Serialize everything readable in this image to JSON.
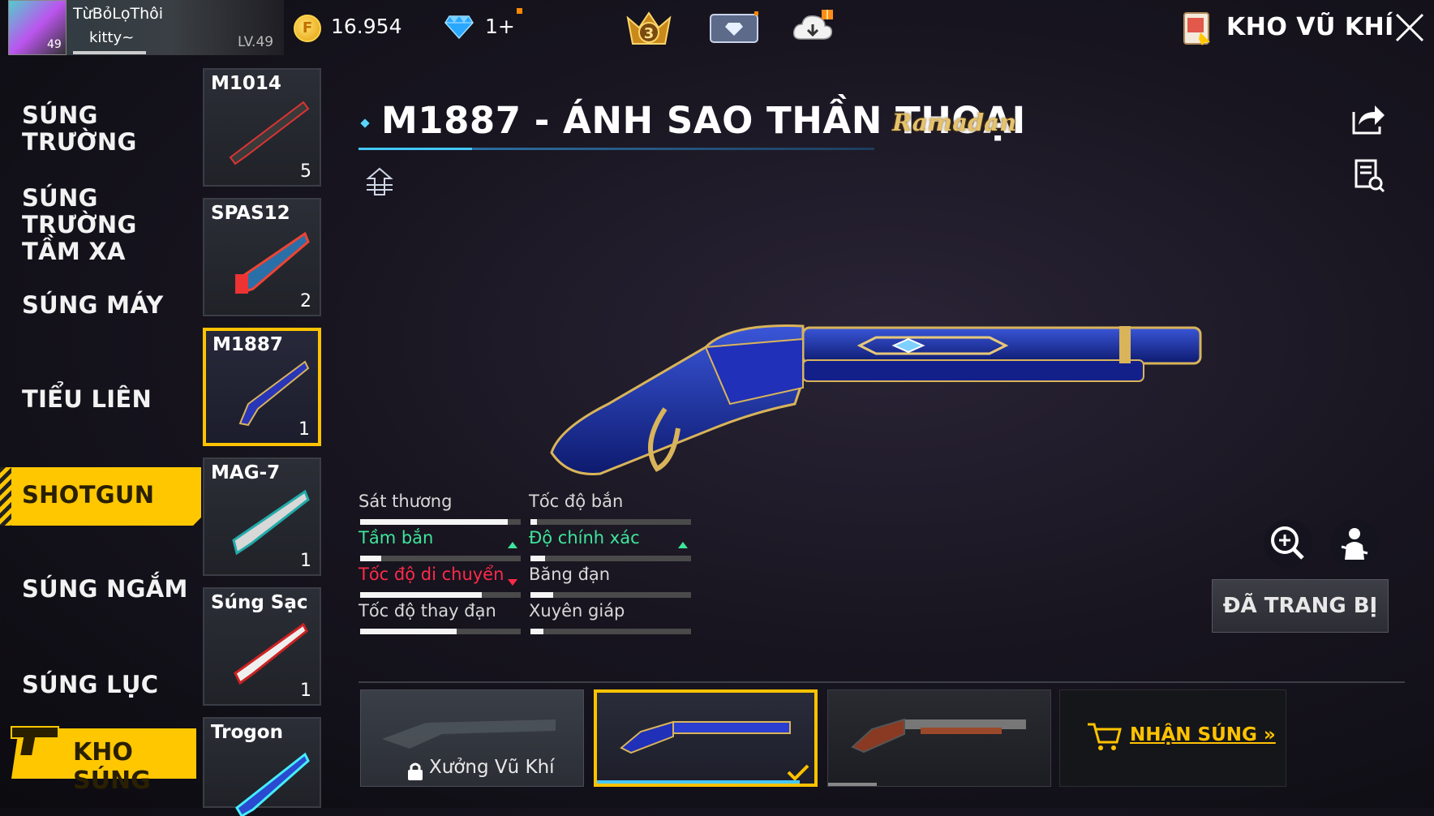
{
  "player": {
    "name": "TừBỏLọThôi",
    "subtitle": "kitty~",
    "level": "LV.49",
    "avatar_level": "49"
  },
  "currency": {
    "gold": "16.954",
    "diamond": "1+"
  },
  "header": {
    "title": "KHO VŨ KHÍ",
    "rank_badge": "3"
  },
  "menu": {
    "items": [
      {
        "label": "SÚNG TRƯỜNG"
      },
      {
        "label": "SÚNG TRƯỜNG TẦM XA"
      },
      {
        "label": "SÚNG MÁY"
      },
      {
        "label": "TIỂU LIÊN"
      },
      {
        "label": "SHOTGUN"
      },
      {
        "label": "SÚNG NGẮM"
      },
      {
        "label": "SÚNG LỤC"
      }
    ],
    "armory_label": "KHO SÚNG"
  },
  "weapons": [
    {
      "name": "M1014",
      "count": "5"
    },
    {
      "name": "SPAS12",
      "count": "2"
    },
    {
      "name": "M1887",
      "count": "1"
    },
    {
      "name": "MAG-7",
      "count": "1"
    },
    {
      "name": "Súng Sạc",
      "count": "1"
    },
    {
      "name": "Trogon",
      "count": ""
    }
  ],
  "skin": {
    "title": "M1887 - ÁNH SAO THẦN THOẠI",
    "tag": "Ramadan"
  },
  "stats": [
    {
      "label": "Sát thương",
      "value": 0.92,
      "state": "normal"
    },
    {
      "label": "Tốc độ bắn",
      "value": 0.04,
      "state": "normal"
    },
    {
      "label": "Tầm bắn",
      "value": 0.13,
      "state": "up"
    },
    {
      "label": "Độ chính xác",
      "value": 0.09,
      "state": "up"
    },
    {
      "label": "Tốc độ di chuyển",
      "value": 0.76,
      "state": "down"
    },
    {
      "label": "Băng đạn",
      "value": 0.14,
      "state": "normal"
    },
    {
      "label": "Tốc độ thay đạn",
      "value": 0.6,
      "state": "normal"
    },
    {
      "label": "Xuyên giáp",
      "value": 0.08,
      "state": "normal"
    }
  ],
  "actions": {
    "equipped": "ĐÃ TRANG BỊ"
  },
  "bottom": {
    "workshop": "Xưởng Vũ Khí",
    "get_gun": "NHẬN SÚNG »"
  },
  "colors": {
    "accent": "#ffc200",
    "stat_up": "#3fe59b",
    "stat_down": "#ff2a4a",
    "title_line": "#44c8ff"
  }
}
